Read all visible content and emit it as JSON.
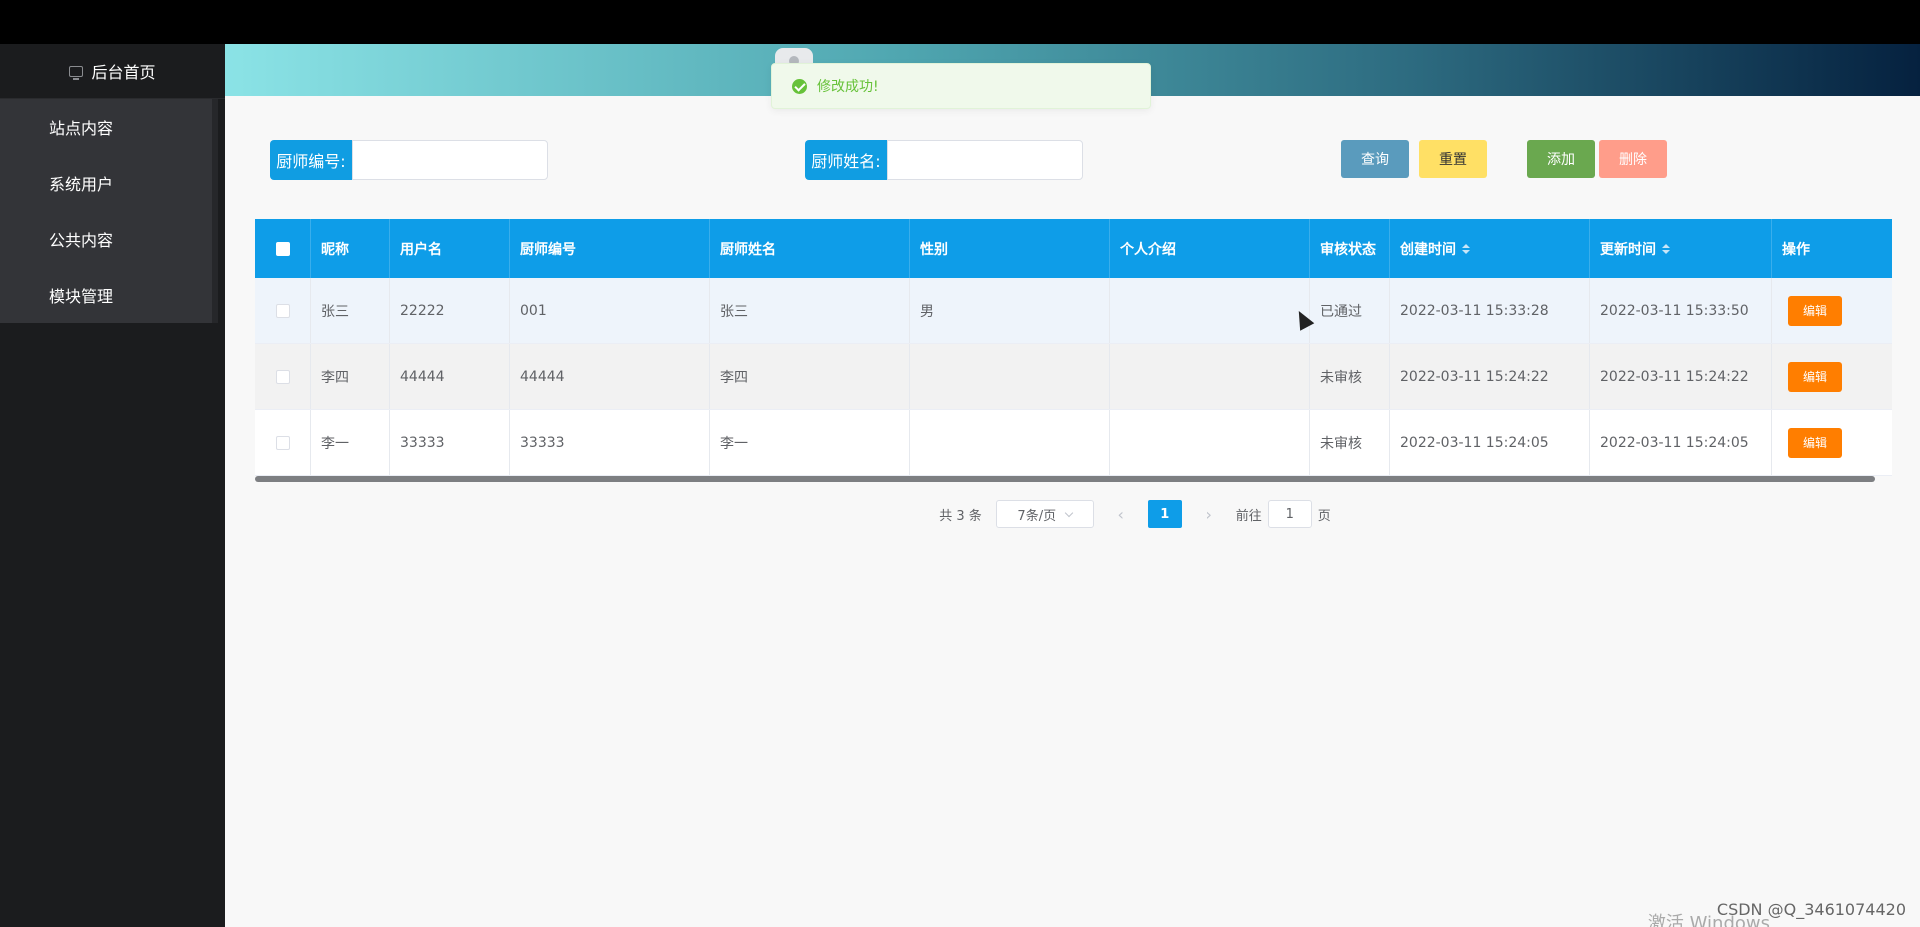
{
  "sidebar": {
    "home_label": "后台首页",
    "items": [
      {
        "label": "站点内容"
      },
      {
        "label": "系统用户"
      },
      {
        "label": "公共内容"
      },
      {
        "label": "模块管理"
      }
    ]
  },
  "toast": {
    "message": "修改成功!"
  },
  "search": {
    "chef_no_label": "厨师编号:",
    "chef_no_value": "",
    "chef_name_label": "厨师姓名:",
    "chef_name_value": ""
  },
  "toolbar": {
    "query_label": "查询",
    "reset_label": "重置",
    "add_label": "添加",
    "delete_label": "删除"
  },
  "colors": {
    "accent": "#0e9de8",
    "query": "#5a9bbd",
    "reset": "#ffe065",
    "add": "#6aa84f",
    "delete": "#ff9d8a",
    "edit": "#ff7e00",
    "success": "#67c23a"
  },
  "table": {
    "columns": [
      "昵称",
      "用户名",
      "厨师编号",
      "厨师姓名",
      "性别",
      "个人介绍",
      "审核状态",
      "创建时间",
      "更新时间",
      "操作"
    ],
    "rows": [
      {
        "nickname": "张三",
        "username": "22222",
        "chef_no": "001",
        "chef_name": "张三",
        "gender": "男",
        "intro": "",
        "status": "已通过",
        "created": "2022-03-11 15:33:28",
        "updated": "2022-03-11 15:33:50",
        "action": "编辑"
      },
      {
        "nickname": "李四",
        "username": "44444",
        "chef_no": "44444",
        "chef_name": "李四",
        "gender": "",
        "intro": "",
        "status": "未审核",
        "created": "2022-03-11 15:24:22",
        "updated": "2022-03-11 15:24:22",
        "action": "编辑"
      },
      {
        "nickname": "李一",
        "username": "33333",
        "chef_no": "33333",
        "chef_name": "李一",
        "gender": "",
        "intro": "",
        "status": "未审核",
        "created": "2022-03-11 15:24:05",
        "updated": "2022-03-11 15:24:05",
        "action": "编辑"
      }
    ]
  },
  "pagination": {
    "total_text": "共 3 条",
    "page_size": "7条/页",
    "current_page": "1",
    "goto_prefix": "前往",
    "goto_value": "1",
    "goto_suffix": "页"
  },
  "watermark": "CSDN @Q_3461074420",
  "activate_text": "激活 Windows"
}
